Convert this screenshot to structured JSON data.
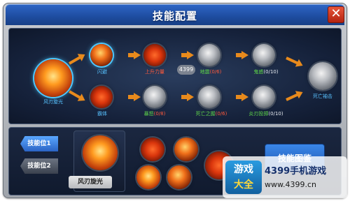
{
  "window": {
    "title": "技能配置",
    "close_icon": "close-icon"
  },
  "tree": {
    "root": {
      "label": "风刃旋光",
      "icon": "whirlwind-fire-icon"
    },
    "top_row": [
      {
        "label": "闪避",
        "level": "",
        "icon": "dodge-icon"
      },
      {
        "label": "上升力量",
        "level": "",
        "icon": "rising-power-icon"
      },
      {
        "label": "地震",
        "level": "0/6",
        "icon": "earthquake-icon"
      },
      {
        "label": "鬼惑",
        "level": "0/10",
        "icon": "ghost-icon"
      }
    ],
    "bottom_row": [
      {
        "label": "霸体",
        "level": "",
        "icon": "super-armor-icon"
      },
      {
        "label": "暴怒",
        "level": "0/8",
        "icon": "rage-icon"
      },
      {
        "label": "死亡之握",
        "level": "0/6",
        "icon": "death-grip-icon"
      },
      {
        "label": "炎刃投掷",
        "level": "0/10",
        "icon": "flame-blade-throw-icon"
      }
    ],
    "end": {
      "label": "死亡袖击",
      "icon": "death-strike-icon"
    },
    "badge": "4399"
  },
  "slots": {
    "slot1": "技能位1",
    "slot2": "技能位2",
    "selected_skill": "风刃旋光"
  },
  "equipped": [
    {
      "icon": "fire-fist-icon"
    },
    {
      "icon": "claw-slash-icon"
    },
    {
      "icon": "flame-wave-icon"
    },
    {
      "icon": "fire-vortex-icon"
    },
    {
      "icon": "fire-orb-icon"
    }
  ],
  "buttons": {
    "encyclopedia": "技能图鉴"
  },
  "watermark": {
    "logo_line1": "游戏",
    "logo_line2": "大全",
    "title": "4399手机游戏",
    "url": "www.4399.cn"
  }
}
